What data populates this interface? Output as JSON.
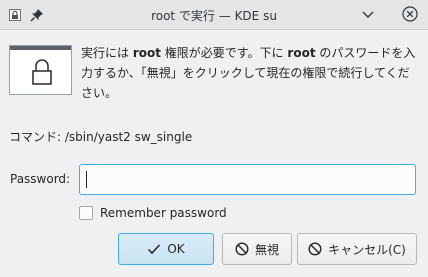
{
  "window": {
    "title": "root で実行 — KDE su"
  },
  "message": {
    "part1": "実行には ",
    "user1": "root",
    "part2": " 権限が必要です。下に ",
    "user2": "root",
    "part3": " のパスワードを入力するか、「無視」をクリックして現在の権限で続行してください。"
  },
  "command": {
    "label": "コマンド: ",
    "value": "/sbin/yast2 sw_single"
  },
  "password": {
    "label": "Password:",
    "value": ""
  },
  "remember": {
    "label": "Remember password",
    "checked": false
  },
  "buttons": {
    "ok": "OK",
    "ignore": "無視",
    "cancel": "キャンセル(C)"
  },
  "colors": {
    "accent": "#3daee9",
    "background": "#eff0f1",
    "text": "#232629"
  },
  "icons": {
    "app": "lock-app-icon",
    "pin": "pin-icon",
    "help": "help-chevron-icon",
    "close": "close-icon",
    "lock": "lock-icon",
    "ok": "checkmark-icon",
    "ignore": "no-entry-icon",
    "cancel": "no-entry-icon"
  }
}
